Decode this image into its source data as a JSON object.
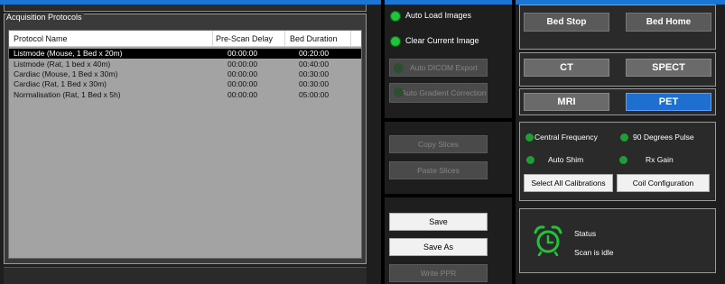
{
  "protocols": {
    "title": "Acquisition Protocols",
    "columns": [
      "Protocol Name",
      "Pre-Scan Delay",
      "Bed Duration"
    ],
    "rows": [
      {
        "name": "Listmode (Mouse, 1 Bed x 20m)",
        "delay": "00:00:00",
        "duration": "00:20:00",
        "selected": true
      },
      {
        "name": "Listmode (Rat, 1 bed x 40m)",
        "delay": "00:00:00",
        "duration": "00:40:00"
      },
      {
        "name": "Cardiac (Mouse, 1 Bed x 30m)",
        "delay": "00:00:00",
        "duration": "00:30:00"
      },
      {
        "name": "Cardiac (Rat, 1 Bed x 30m)",
        "delay": "00:00:00",
        "duration": "00:30:00"
      },
      {
        "name": "Normalisation (Rat, 1 Bed x 5h)",
        "delay": "00:00:00",
        "duration": "05:00:00"
      }
    ]
  },
  "options": {
    "auto_load_images": "Auto Load Images",
    "clear_current_image": "Clear Current Image",
    "auto_dicom_export": "Auto DICOM Export",
    "auto_gradient_correction": "Auto Gradient Correction"
  },
  "actions": {
    "copy_slices": "Copy Slices",
    "paste_slices": "Paste Slices",
    "save": "Save",
    "save_as": "Save As",
    "write_ppr": "Write PPR"
  },
  "bed": {
    "stop": "Bed Stop",
    "home": "Bed Home"
  },
  "modalities": {
    "ct": "CT",
    "spect": "SPECT",
    "mri": "MRI",
    "pet": "PET",
    "active": "PET"
  },
  "calibrations": {
    "central_frequency": "Central Frequency",
    "ninety_degrees_pulse": "90 Degrees Pulse",
    "auto_shim": "Auto Shim",
    "rx_gain": "Rx Gain",
    "select_all": "Select All Calibrations",
    "coil_configuration": "Coil Configuration"
  },
  "status": {
    "label": "Status",
    "text": "Scan is idle"
  },
  "colors": {
    "accent": "#1976d2",
    "active_mode": "#1f6fd1",
    "led_on": "#22c33a"
  }
}
